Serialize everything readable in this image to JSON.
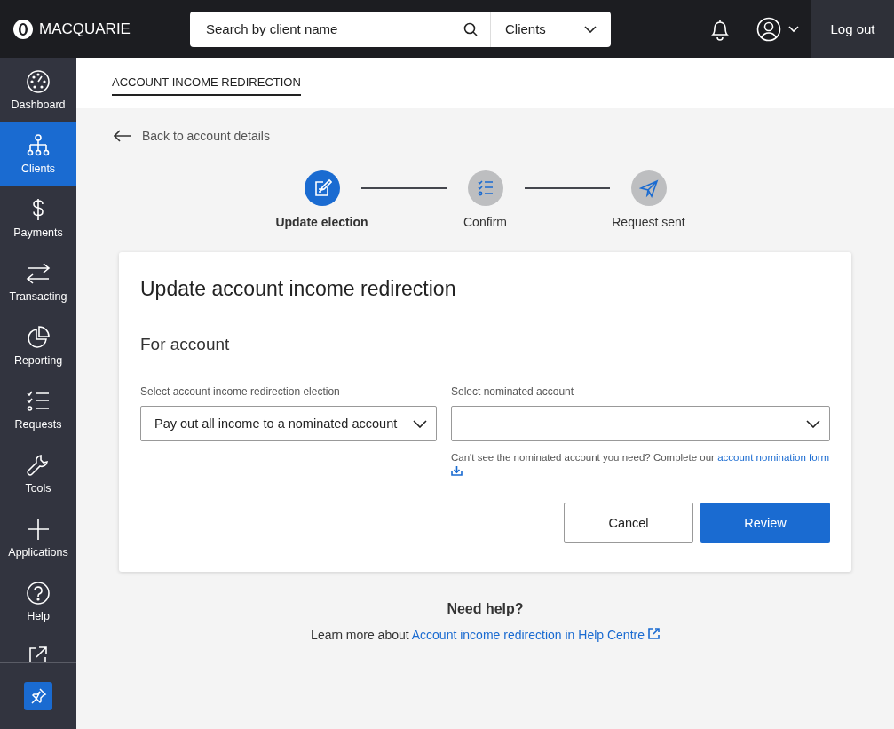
{
  "header": {
    "logo": "MACQUARIE",
    "search": {
      "placeholder": "Search by client name"
    },
    "scope_select": {
      "value": "Clients"
    },
    "logout": "Log out"
  },
  "sidebar": {
    "items": [
      {
        "label": "Dashboard",
        "selected": false
      },
      {
        "label": "Clients",
        "selected": true
      },
      {
        "label": "Payments",
        "selected": false
      },
      {
        "label": "Transacting",
        "selected": false
      },
      {
        "label": "Reporting",
        "selected": false
      },
      {
        "label": "Requests",
        "selected": false
      },
      {
        "label": "Tools",
        "selected": false
      },
      {
        "label": "Applications",
        "selected": false
      },
      {
        "label": "Help",
        "selected": false
      }
    ]
  },
  "page_tab": {
    "label": "ACCOUNT INCOME REDIRECTION",
    "selected": true
  },
  "back_link": "Back to account details",
  "steps": [
    {
      "label": "Update election",
      "selected": true
    },
    {
      "label": "Confirm",
      "selected": false
    },
    {
      "label": "Request sent",
      "selected": false
    }
  ],
  "card": {
    "title": "Update account income redirection",
    "subtitle": "For account",
    "fields": [
      {
        "label": "Select account income redirection election",
        "value": "Pay out all income to a nominated account"
      },
      {
        "label": "Select nominated account"
      }
    ],
    "note": {
      "text": "Can't see the nominated account you need? Complete our",
      "link": "account nomination form"
    },
    "buttons": [
      {
        "label": "Cancel",
        "kind": "secondary"
      },
      {
        "label": "Review",
        "kind": "primary"
      }
    ]
  },
  "help": {
    "title": "Need help?",
    "text": "Learn more about",
    "link": "Account income redirection in Help Centre"
  }
}
